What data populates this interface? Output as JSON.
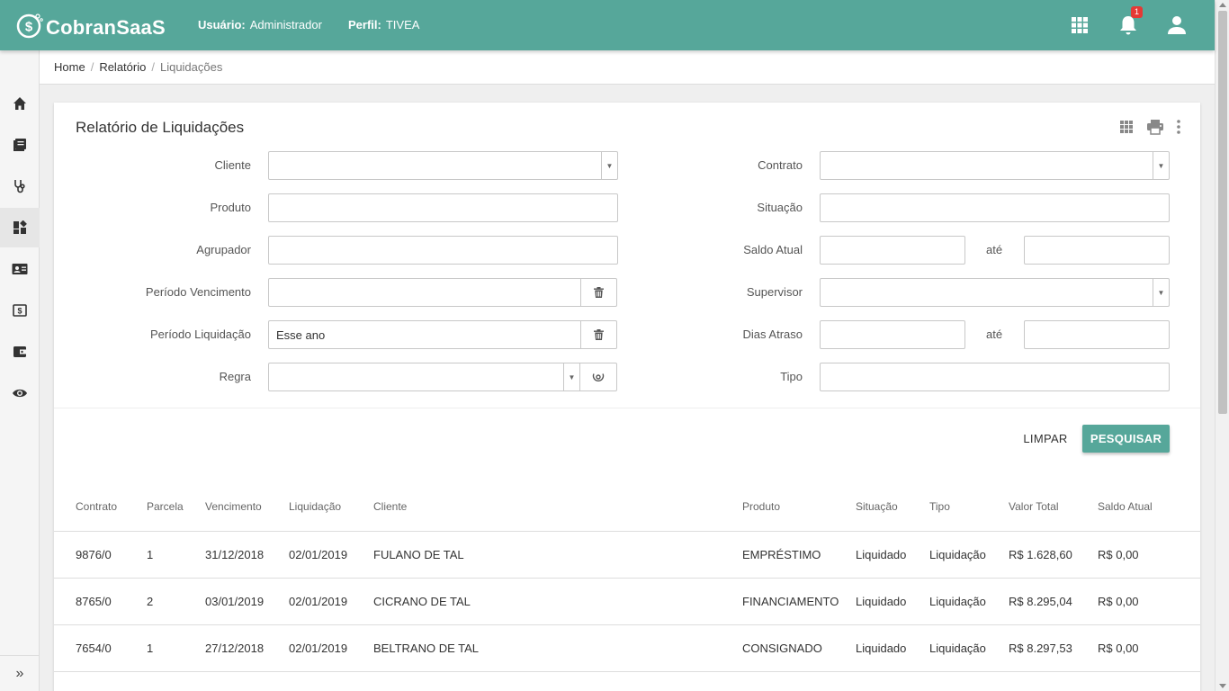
{
  "header": {
    "logo_text": "CobranSaaS",
    "user_label": "Usuário:",
    "user_value": "Administrador",
    "profile_label": "Perfil:",
    "profile_value": "TIVEA",
    "notification_count": "1",
    "color": "#56a79a"
  },
  "sidebar": {
    "items": [
      "home-icon",
      "book-icon",
      "stethoscope-icon",
      "dashboard-icon",
      "contact-card-icon",
      "money-icon",
      "wallet-icon",
      "eye-icon"
    ],
    "expand_glyph": "»"
  },
  "breadcrumb": {
    "items": [
      "Home",
      "Relatório"
    ],
    "current": "Liquidações"
  },
  "card": {
    "title": "Relatório de Liquidações"
  },
  "form": {
    "cliente_label": "Cliente",
    "produto_label": "Produto",
    "agrupador_label": "Agrupador",
    "periodo_vencimento_label": "Período Vencimento",
    "periodo_liquidacao_label": "Período Liquidação",
    "periodo_liquidacao_value": "Esse ano",
    "regra_label": "Regra",
    "contrato_label": "Contrato",
    "situacao_label": "Situação",
    "saldo_atual_label": "Saldo Atual",
    "ate_label": "até",
    "supervisor_label": "Supervisor",
    "dias_atraso_label": "Dias Atraso",
    "tipo_label": "Tipo",
    "limpar": "LIMPAR",
    "pesquisar": "PESQUISAR"
  },
  "table": {
    "headers": [
      "Contrato",
      "Parcela",
      "Vencimento",
      "Liquidação",
      "Cliente",
      "Produto",
      "Situação",
      "Tipo",
      "Valor Total",
      "Saldo Atual"
    ],
    "rows": [
      [
        "9876/0",
        "1",
        "31/12/2018",
        "02/01/2019",
        "FULANO DE TAL",
        "EMPRÉSTIMO",
        "Liquidado",
        "Liquidação",
        "R$ 1.628,60",
        "R$ 0,00"
      ],
      [
        "8765/0",
        "2",
        "03/01/2019",
        "02/01/2019",
        "CICRANO DE TAL",
        "FINANCIAMENTO",
        "Liquidado",
        "Liquidação",
        "R$ 8.295,04",
        "R$ 0,00"
      ],
      [
        "7654/0",
        "1",
        "27/12/2018",
        "02/01/2019",
        "BELTRANO DE TAL",
        "CONSIGNADO",
        "Liquidado",
        "Liquidação",
        "R$ 8.297,53",
        "R$ 0,00"
      ]
    ]
  }
}
